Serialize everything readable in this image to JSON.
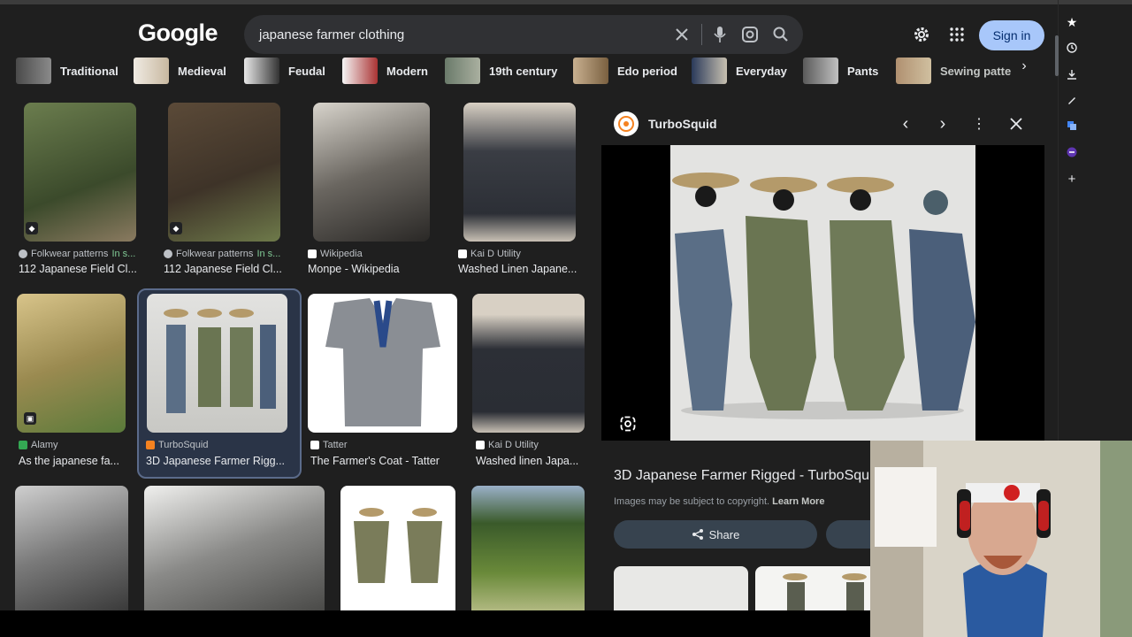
{
  "logo": "Google",
  "search": {
    "query": "japanese farmer clothing"
  },
  "header": {
    "sign_in": "Sign in"
  },
  "chips": [
    {
      "label": "Traditional"
    },
    {
      "label": "Medieval"
    },
    {
      "label": "Feudal"
    },
    {
      "label": "Modern"
    },
    {
      "label": "19th century"
    },
    {
      "label": "Edo period"
    },
    {
      "label": "Everyday"
    },
    {
      "label": "Pants"
    },
    {
      "label": "Sewing patte"
    }
  ],
  "results": [
    {
      "source": "Folkwear patterns",
      "badge": "In s...",
      "title": "112 Japanese Field Cl..."
    },
    {
      "source": "Folkwear patterns",
      "badge": "In s...",
      "title": "112 Japanese Field Cl..."
    },
    {
      "source": "Wikipedia",
      "title": "Monpe - Wikipedia"
    },
    {
      "source": "Kai D Utility",
      "title": "Washed Linen Japane..."
    },
    {
      "source": "Alamy",
      "title": "As the japanese fa..."
    },
    {
      "source": "TurboSquid",
      "title": "3D Japanese Farmer Rigg..."
    },
    {
      "source": "Tatter",
      "title": "The Farmer's Coat - Tatter"
    },
    {
      "source": "Kai D Utility",
      "title": "Washed linen Japa..."
    }
  ],
  "panel": {
    "source": "TurboSquid",
    "title": "3D Japanese Farmer Rigged - TurboSquid",
    "copyright": "Images may be subject to copyright.",
    "learn_more": "Learn More",
    "share": "Share"
  },
  "colors": {
    "accent": "#a8c7fa",
    "background": "#1f1f1f",
    "chip_text": "#e8eaed",
    "in_stock": "#81c995"
  }
}
